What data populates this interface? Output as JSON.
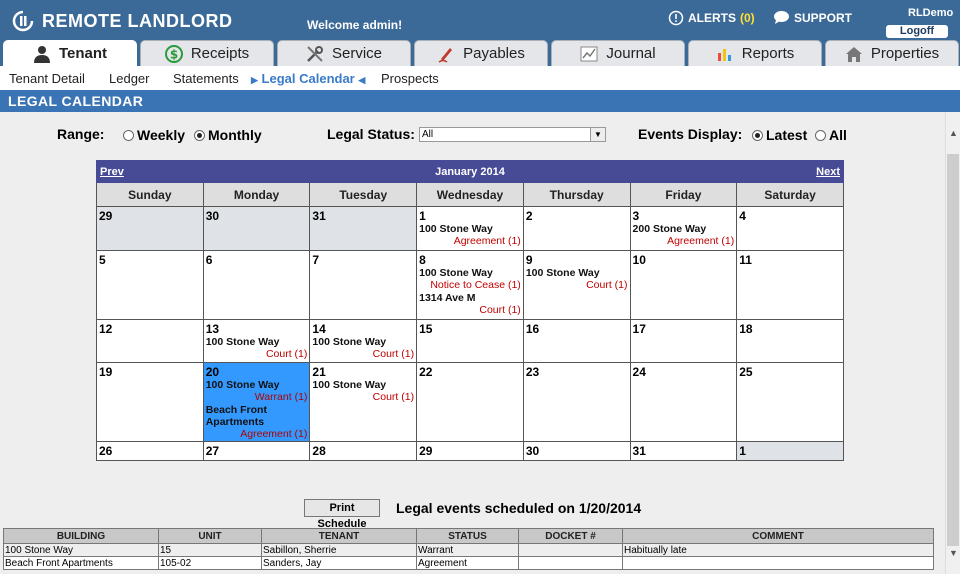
{
  "header": {
    "app_title": "REMOTE LANDLORD",
    "welcome": "Welcome admin!",
    "alerts_label": "ALERTS",
    "alerts_count": "(0)",
    "support_label": "SUPPORT",
    "user": "RLDemo",
    "logoff_label": "Logoff"
  },
  "tabs": [
    {
      "label": "Tenant",
      "icon": "person-icon",
      "active": true
    },
    {
      "label": "Receipts",
      "icon": "dollar-icon",
      "active": false
    },
    {
      "label": "Service",
      "icon": "tools-icon",
      "active": false
    },
    {
      "label": "Payables",
      "icon": "pen-icon",
      "active": false
    },
    {
      "label": "Journal",
      "icon": "line-chart-icon",
      "active": false
    },
    {
      "label": "Reports",
      "icon": "bar-chart-icon",
      "active": false
    },
    {
      "label": "Properties",
      "icon": "house-icon",
      "active": false
    }
  ],
  "subnav": {
    "items": [
      "Tenant Detail",
      "Ledger",
      "Statements",
      "Legal Calendar",
      "Prospects"
    ],
    "current_index": 3
  },
  "section_title": "LEGAL CALENDAR",
  "filters": {
    "range_label": "Range:",
    "range_options": [
      "Weekly",
      "Monthly"
    ],
    "range_selected": "Monthly",
    "legal_status_label": "Legal Status:",
    "legal_status_value": "All",
    "events_label": "Events Display:",
    "events_options": [
      "Latest",
      "All"
    ],
    "events_selected": "Latest"
  },
  "calendar": {
    "prev_label": "Prev",
    "next_label": "Next",
    "month_title": "January 2014",
    "weekdays": [
      "Sunday",
      "Monday",
      "Tuesday",
      "Wednesday",
      "Thursday",
      "Friday",
      "Saturday"
    ],
    "weeks": [
      [
        {
          "d": "29",
          "other": true
        },
        {
          "d": "30",
          "other": true
        },
        {
          "d": "31",
          "other": true
        },
        {
          "d": "1",
          "ev": [
            {
              "addr": "100 Stone Way",
              "type": "Agreement (1)"
            }
          ]
        },
        {
          "d": "2"
        },
        {
          "d": "3",
          "ev": [
            {
              "addr": "200 Stone Way",
              "type": "Agreement (1)"
            }
          ]
        },
        {
          "d": "4"
        }
      ],
      [
        {
          "d": "5"
        },
        {
          "d": "6"
        },
        {
          "d": "7"
        },
        {
          "d": "8",
          "ev": [
            {
              "addr": "100 Stone Way",
              "type": "Notice to Cease (1)"
            },
            {
              "addr": "1314 Ave M",
              "type": "Court (1)"
            }
          ]
        },
        {
          "d": "9",
          "ev": [
            {
              "addr": "100 Stone Way",
              "type": "Court (1)"
            }
          ]
        },
        {
          "d": "10"
        },
        {
          "d": "11"
        }
      ],
      [
        {
          "d": "12"
        },
        {
          "d": "13",
          "ev": [
            {
              "addr": "100 Stone Way",
              "type": "Court (1)"
            }
          ]
        },
        {
          "d": "14",
          "ev": [
            {
              "addr": "100 Stone Way",
              "type": "Court (1)"
            }
          ]
        },
        {
          "d": "15"
        },
        {
          "d": "16"
        },
        {
          "d": "17"
        },
        {
          "d": "18"
        }
      ],
      [
        {
          "d": "19"
        },
        {
          "d": "20",
          "selected": true,
          "ev": [
            {
              "addr": "100 Stone Way",
              "type": "Warrant (1)"
            },
            {
              "addr": "Beach Front Apartments",
              "type": "Agreement (1)"
            }
          ]
        },
        {
          "d": "21",
          "ev": [
            {
              "addr": "100 Stone Way",
              "type": "Court (1)"
            }
          ]
        },
        {
          "d": "22"
        },
        {
          "d": "23"
        },
        {
          "d": "24"
        },
        {
          "d": "25"
        }
      ],
      [
        {
          "d": "26"
        },
        {
          "d": "27"
        },
        {
          "d": "28"
        },
        {
          "d": "29"
        },
        {
          "d": "30"
        },
        {
          "d": "31"
        },
        {
          "d": "1",
          "other": true
        }
      ]
    ]
  },
  "print_label": "Print Schedule",
  "schedule_message": "Legal events scheduled on 1/20/2014",
  "events_table": {
    "columns": [
      "BUILDING",
      "UNIT",
      "TENANT",
      "STATUS",
      "DOCKET #",
      "COMMENT"
    ],
    "rows": [
      [
        "100 Stone Way",
        "15",
        "Sabillon, Sherrie",
        "Warrant",
        "",
        "Habitually late"
      ],
      [
        "Beach Front Apartments",
        "105-02",
        "Sanders, Jay",
        "Agreement",
        "",
        ""
      ]
    ]
  },
  "colors": {
    "header_bg": "#3b6a99",
    "section_bar": "#3b74b4",
    "calendar_nav": "#474a94",
    "selected_day": "#3399ff",
    "event_type": "#c00000"
  }
}
